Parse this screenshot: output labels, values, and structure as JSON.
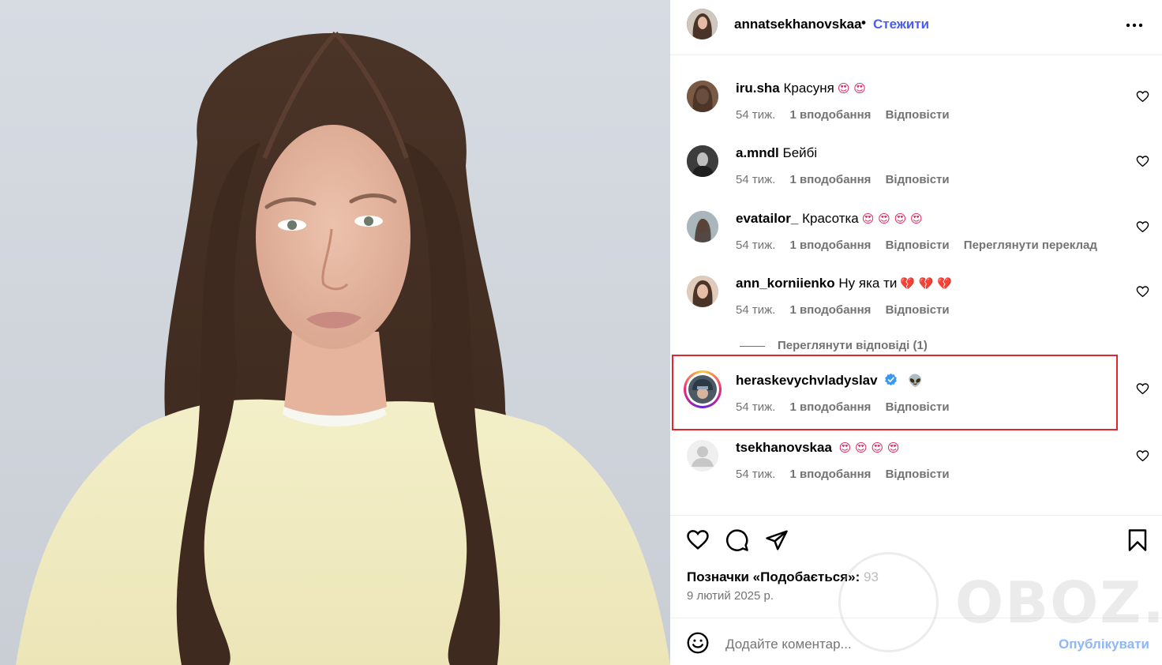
{
  "post": {
    "author": "annatsekhanovskaa",
    "separator": "•",
    "follow_label": "Стежити",
    "likes_label": "Позначки «Подобається»:",
    "likes_count": "93",
    "date": "9 лютий 2025 р.",
    "add_comment_placeholder": "Додайте коментар...",
    "publish_label": "Опублікувати"
  },
  "comments": [
    {
      "user": "iru.sha",
      "text": "Красуня",
      "emoji": "😍 😍",
      "age": "54 тиж.",
      "likes": "1 вподобання",
      "reply": "Відповісти",
      "translate": ""
    },
    {
      "user": "a.mndl",
      "text": "Бейбі",
      "emoji": "",
      "age": "54 тиж.",
      "likes": "1 вподобання",
      "reply": "Відповісти",
      "translate": ""
    },
    {
      "user": "evatailor_",
      "text": "Красотка",
      "emoji": "😍 😍 😍 😍",
      "age": "54 тиж.",
      "likes": "1 вподобання",
      "reply": "Відповісти",
      "translate": "Переглянути переклад"
    },
    {
      "user": "ann_korniienko",
      "text": "Ну яка ти",
      "emoji": "💔 💔 💔",
      "age": "54 тиж.",
      "likes": "1 вподобання",
      "reply": "Відповісти",
      "translate": ""
    },
    {
      "user": "heraskevychvladyslav",
      "text": "",
      "emoji": "👽",
      "age": "54 тиж.",
      "likes": "1 вподобання",
      "reply": "Відповісти",
      "translate": ""
    },
    {
      "user": "tsekhanovskaa",
      "text": "",
      "emoji": "😍 😍 😍 😍",
      "age": "54 тиж.",
      "likes": "1 вподобання",
      "reply": "Відповісти",
      "translate": ""
    }
  ],
  "view_replies": "Переглянути відповіді (1)",
  "watermark": "OBOZ.UA",
  "colors": {
    "accent": "#4a5df9",
    "highlight": "#e2262f",
    "muted": "#737373",
    "publish": "#8fb6f7"
  }
}
